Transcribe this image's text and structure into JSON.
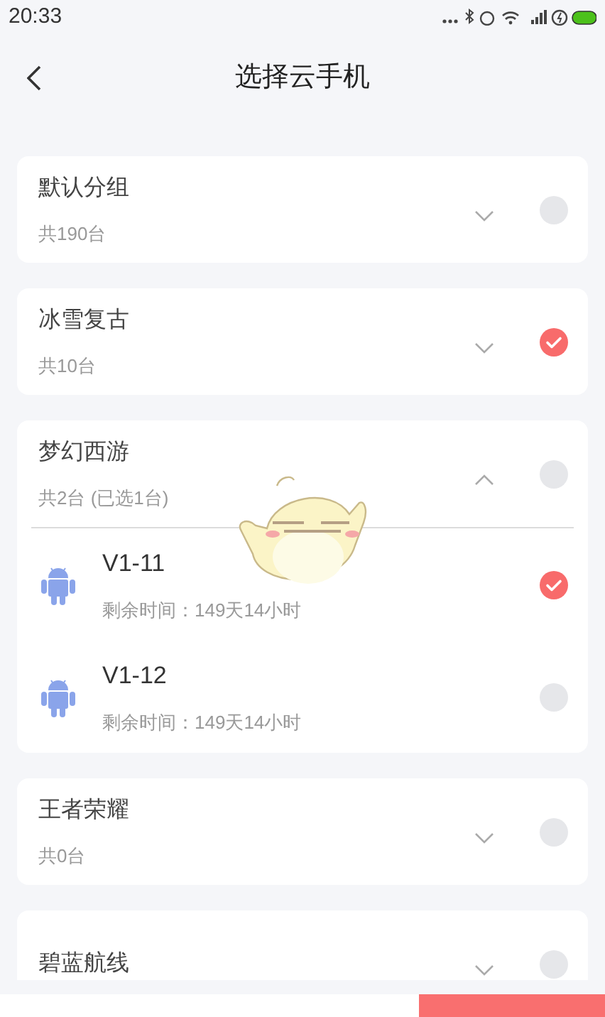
{
  "status_bar": {
    "time": "20:33"
  },
  "header": {
    "title": "选择云手机"
  },
  "groups": [
    {
      "name": "默认分组",
      "count": "共190台",
      "expanded": false,
      "selected": false
    },
    {
      "name": "冰雪复古",
      "count": "共10台",
      "expanded": false,
      "selected": true
    },
    {
      "name": "梦幻西游",
      "count": "共2台 (已选1台)",
      "expanded": true,
      "selected": false,
      "devices": [
        {
          "name": "V1-11",
          "remaining": "剩余时间：149天14小时",
          "selected": true
        },
        {
          "name": "V1-12",
          "remaining": "剩余时间：149天14小时",
          "selected": false
        }
      ]
    },
    {
      "name": "王者荣耀",
      "count": "共0台",
      "expanded": false,
      "selected": false
    },
    {
      "name": "碧蓝航线",
      "expanded": false,
      "selected": false
    }
  ]
}
